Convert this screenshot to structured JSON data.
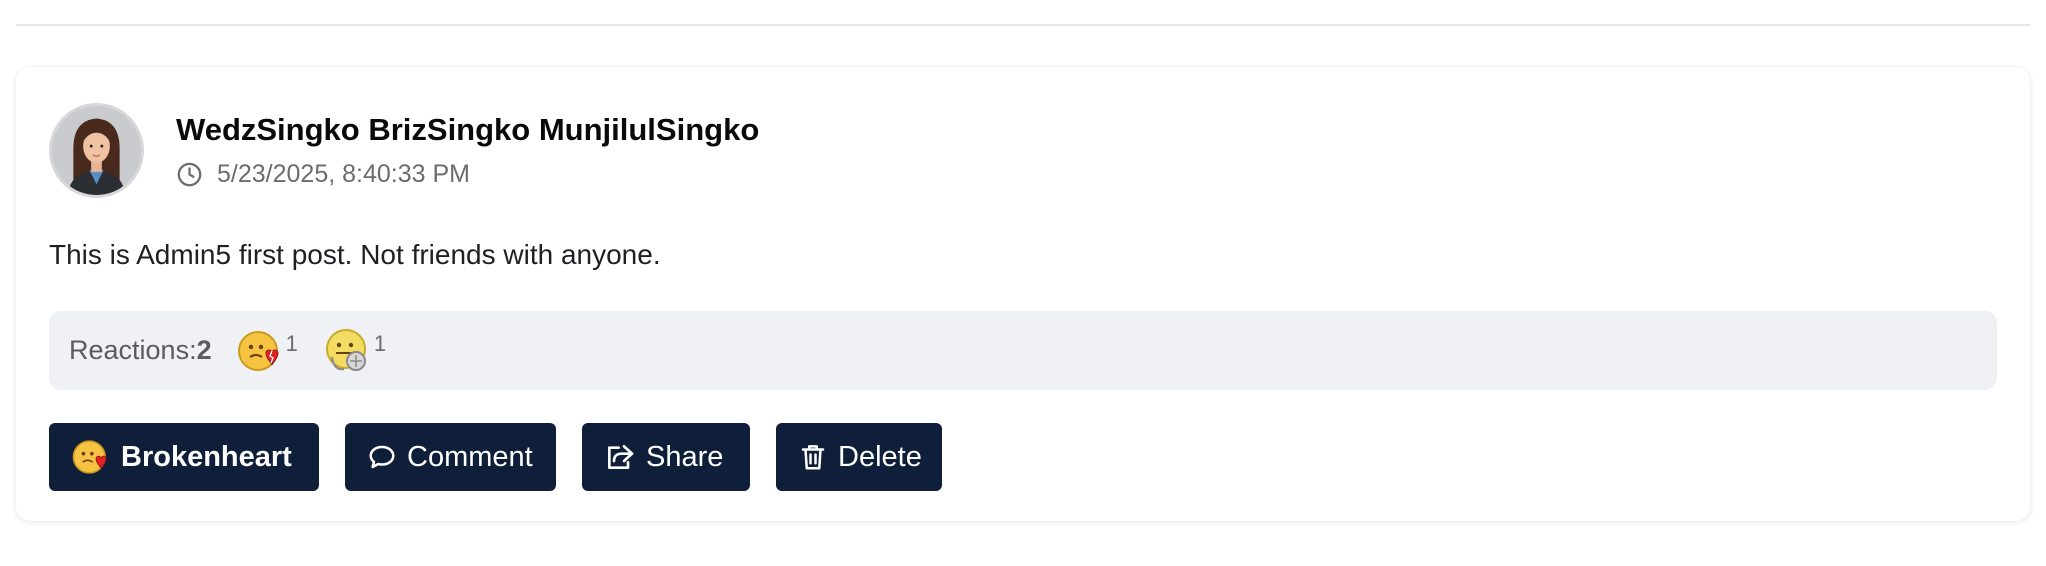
{
  "post": {
    "author": "WedzSingko BrizSingko MunjilulSingko",
    "timestamp": "5/23/2025, 8:40:33 PM",
    "body": "This is Admin5 first post. Not friends with anyone."
  },
  "reactions": {
    "label": "Reactions:",
    "total": "2",
    "items": [
      {
        "icon": "brokenheart-emoji-icon",
        "count": "1"
      },
      {
        "icon": "skeptical-emoji-icon",
        "count": "1"
      }
    ]
  },
  "actions": {
    "react_label": "Brokenheart",
    "comment_label": "Comment",
    "share_label": "Share",
    "delete_label": "Delete"
  },
  "colors": {
    "button_bg": "#0f1f3a",
    "reactions_bg": "#f0f1f5",
    "muted_text": "#6b6b72"
  }
}
